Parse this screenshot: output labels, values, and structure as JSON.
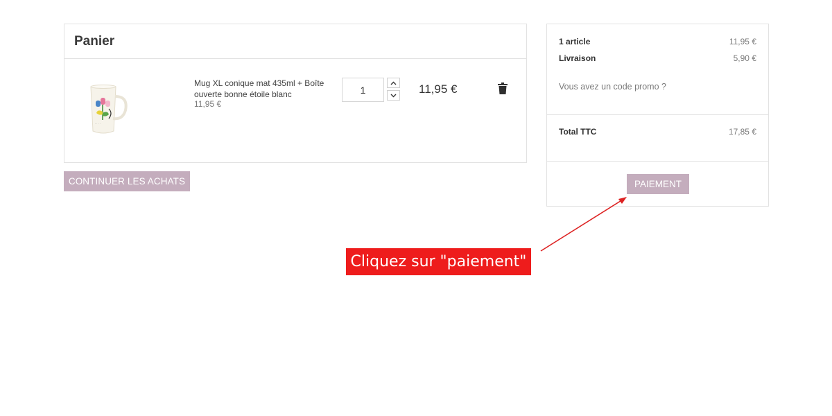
{
  "cart": {
    "title": "Panier",
    "items": [
      {
        "name": "Mug XL conique mat 435ml + Boîte ouverte bonne étoile blanc",
        "unit_price": "11,95 €",
        "quantity": "1",
        "total": "11,95 €",
        "image": "mug-product-image",
        "remove_icon": "trash-icon"
      }
    ],
    "qty_up_icon": "chevron-up-icon",
    "qty_down_icon": "chevron-down-icon"
  },
  "continue_button": "CONTINUER LES ACHATS",
  "summary": {
    "articles_label": "1 article",
    "articles_value": "11,95 €",
    "shipping_label": "Livraison",
    "shipping_value": "5,90 €",
    "promo_link": "Vous avez un code promo ?",
    "total_label": "Total TTC",
    "total_value": "17,85 €",
    "pay_button": "PAIEMENT"
  },
  "annotation": {
    "text": "Cliquez sur \"paiement\"",
    "color": "#ee1c1c"
  },
  "colors": {
    "accent_button": "#c4adbd",
    "annotation_red": "#ee1c1c"
  }
}
